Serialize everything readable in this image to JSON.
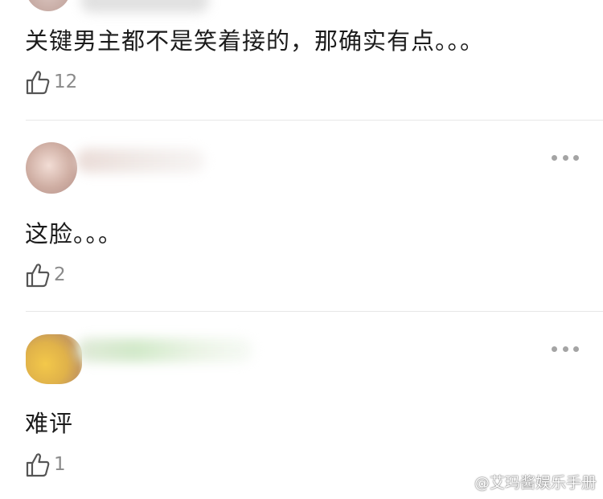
{
  "comments": [
    {
      "text": "关键男主都不是笑着接的，那确实有点。。。",
      "likes": "12"
    },
    {
      "text": "这脸。。。",
      "likes": "2"
    },
    {
      "text": "难评",
      "likes": "1"
    }
  ],
  "watermark": {
    "text": "@艾玛酱娱乐手册"
  },
  "colors": {
    "text": "#1b1b1b",
    "meta": "#8a8a8a",
    "divider": "#e7e7e7",
    "dots": "#a4a4a4"
  },
  "icons": {
    "like": "thumbs-up-icon",
    "more": "more-dots-icon",
    "watermark": "weibo-logo-icon"
  }
}
